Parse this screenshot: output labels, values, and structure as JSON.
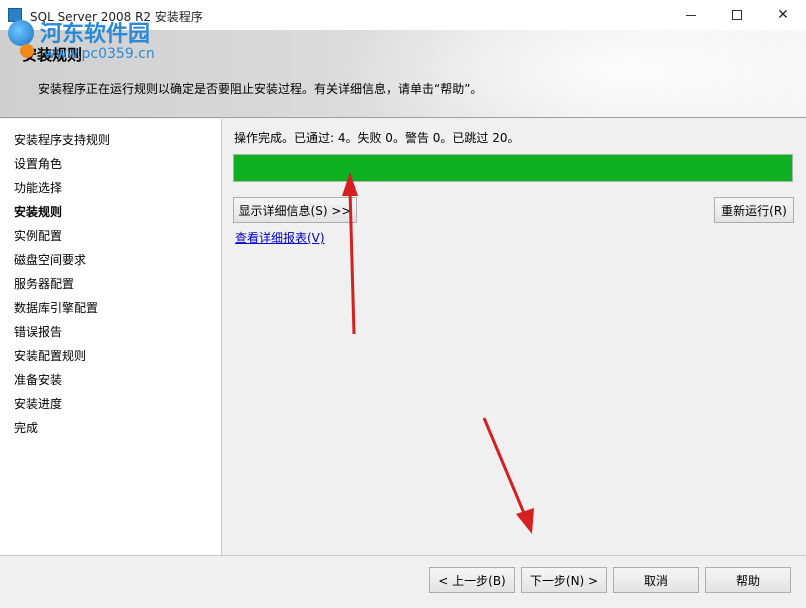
{
  "window": {
    "title": "SQL Server 2008 R2 安装程序",
    "minimize_icon": "minimize-icon",
    "maximize_icon": "maximize-icon",
    "close_icon": "close-icon",
    "close_glyph": "✕"
  },
  "watermark": {
    "name": "河东软件园",
    "url": "www.pc0359.cn"
  },
  "header": {
    "title": "安装规则",
    "description": "安装程序正在运行规则以确定是否要阻止安装过程。有关详细信息，请单击“帮助”。"
  },
  "nav": {
    "items": [
      {
        "label": "安装程序支持规则",
        "active": false
      },
      {
        "label": "设置角色",
        "active": false
      },
      {
        "label": "功能选择",
        "active": false
      },
      {
        "label": "安装规则",
        "active": true
      },
      {
        "label": "实例配置",
        "active": false
      },
      {
        "label": "磁盘空间要求",
        "active": false
      },
      {
        "label": "服务器配置",
        "active": false
      },
      {
        "label": "数据库引擎配置",
        "active": false
      },
      {
        "label": "错误报告",
        "active": false
      },
      {
        "label": "安装配置规则",
        "active": false
      },
      {
        "label": "准备安装",
        "active": false
      },
      {
        "label": "安装进度",
        "active": false
      },
      {
        "label": "完成",
        "active": false
      }
    ]
  },
  "content": {
    "status": "操作完成。已通过: 4。失败 0。警告 0。已跳过 20。",
    "progress_percent": 100,
    "progress_color": "#0fb124",
    "show_details_label": "显示详细信息(S) >>",
    "rerun_label": "重新运行(R)",
    "report_link": "查看详细报表(V)"
  },
  "footer": {
    "back_label": "< 上一步(B)",
    "next_label": "下一步(N) >",
    "cancel_label": "取消",
    "help_label": "帮助"
  },
  "annotation_color": "#d42020"
}
